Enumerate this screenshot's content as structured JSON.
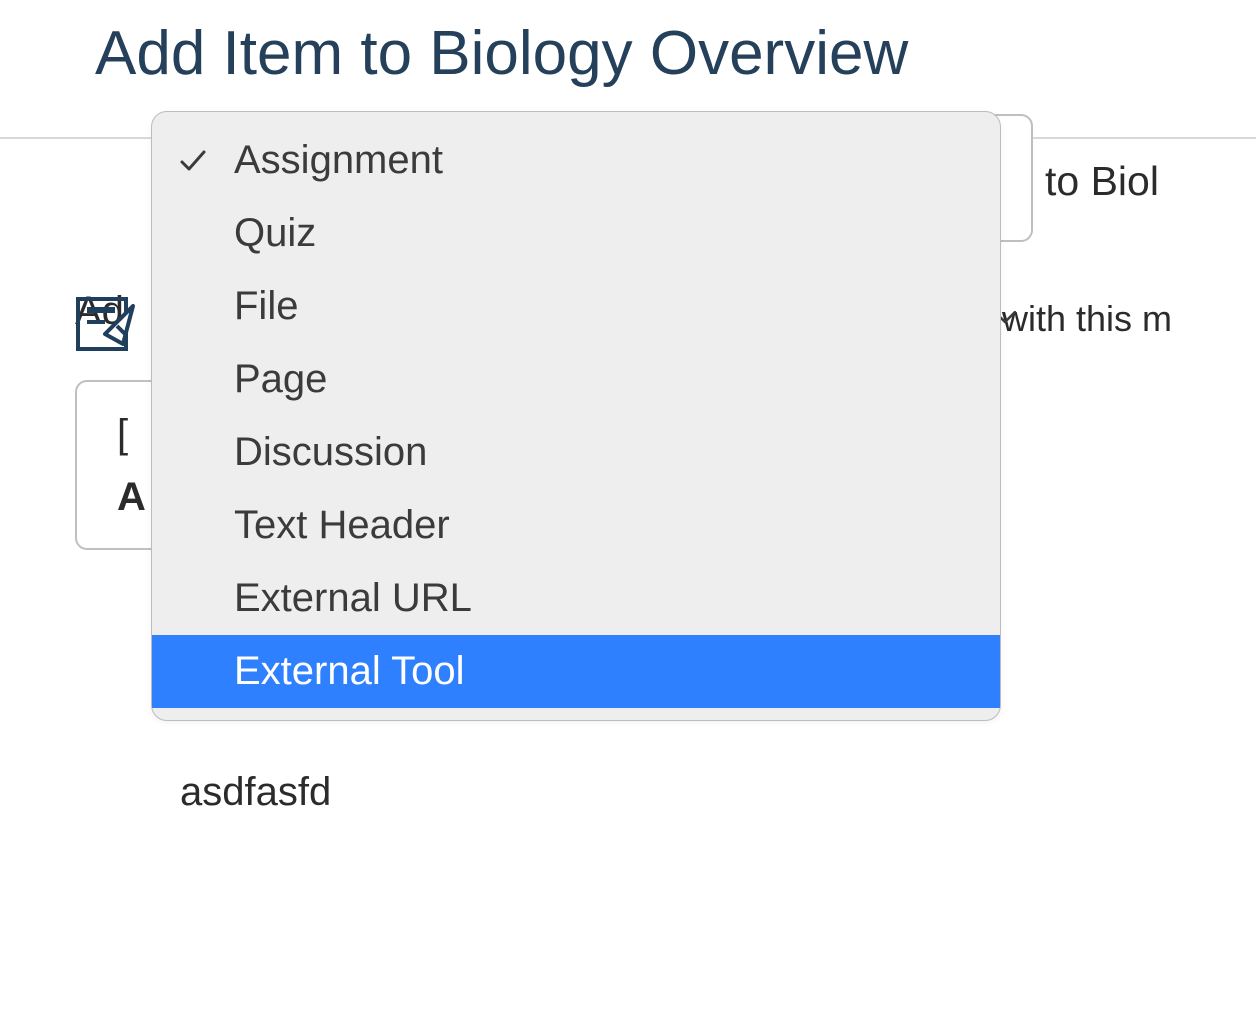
{
  "header": {
    "title": "Add Item to Biology Overview"
  },
  "addRow": {
    "prefix": "Ad",
    "suffix": "to Biol"
  },
  "hintSuffix": "with this m",
  "listbox": {
    "item1": "[",
    "item2": "A"
  },
  "partialText": "asdfasfd",
  "dropdown": {
    "selectedIndex": 0,
    "highlightedIndex": 7,
    "items": [
      "Assignment",
      "Quiz",
      "File",
      "Page",
      "Discussion",
      "Text Header",
      "External URL",
      "External Tool"
    ]
  }
}
